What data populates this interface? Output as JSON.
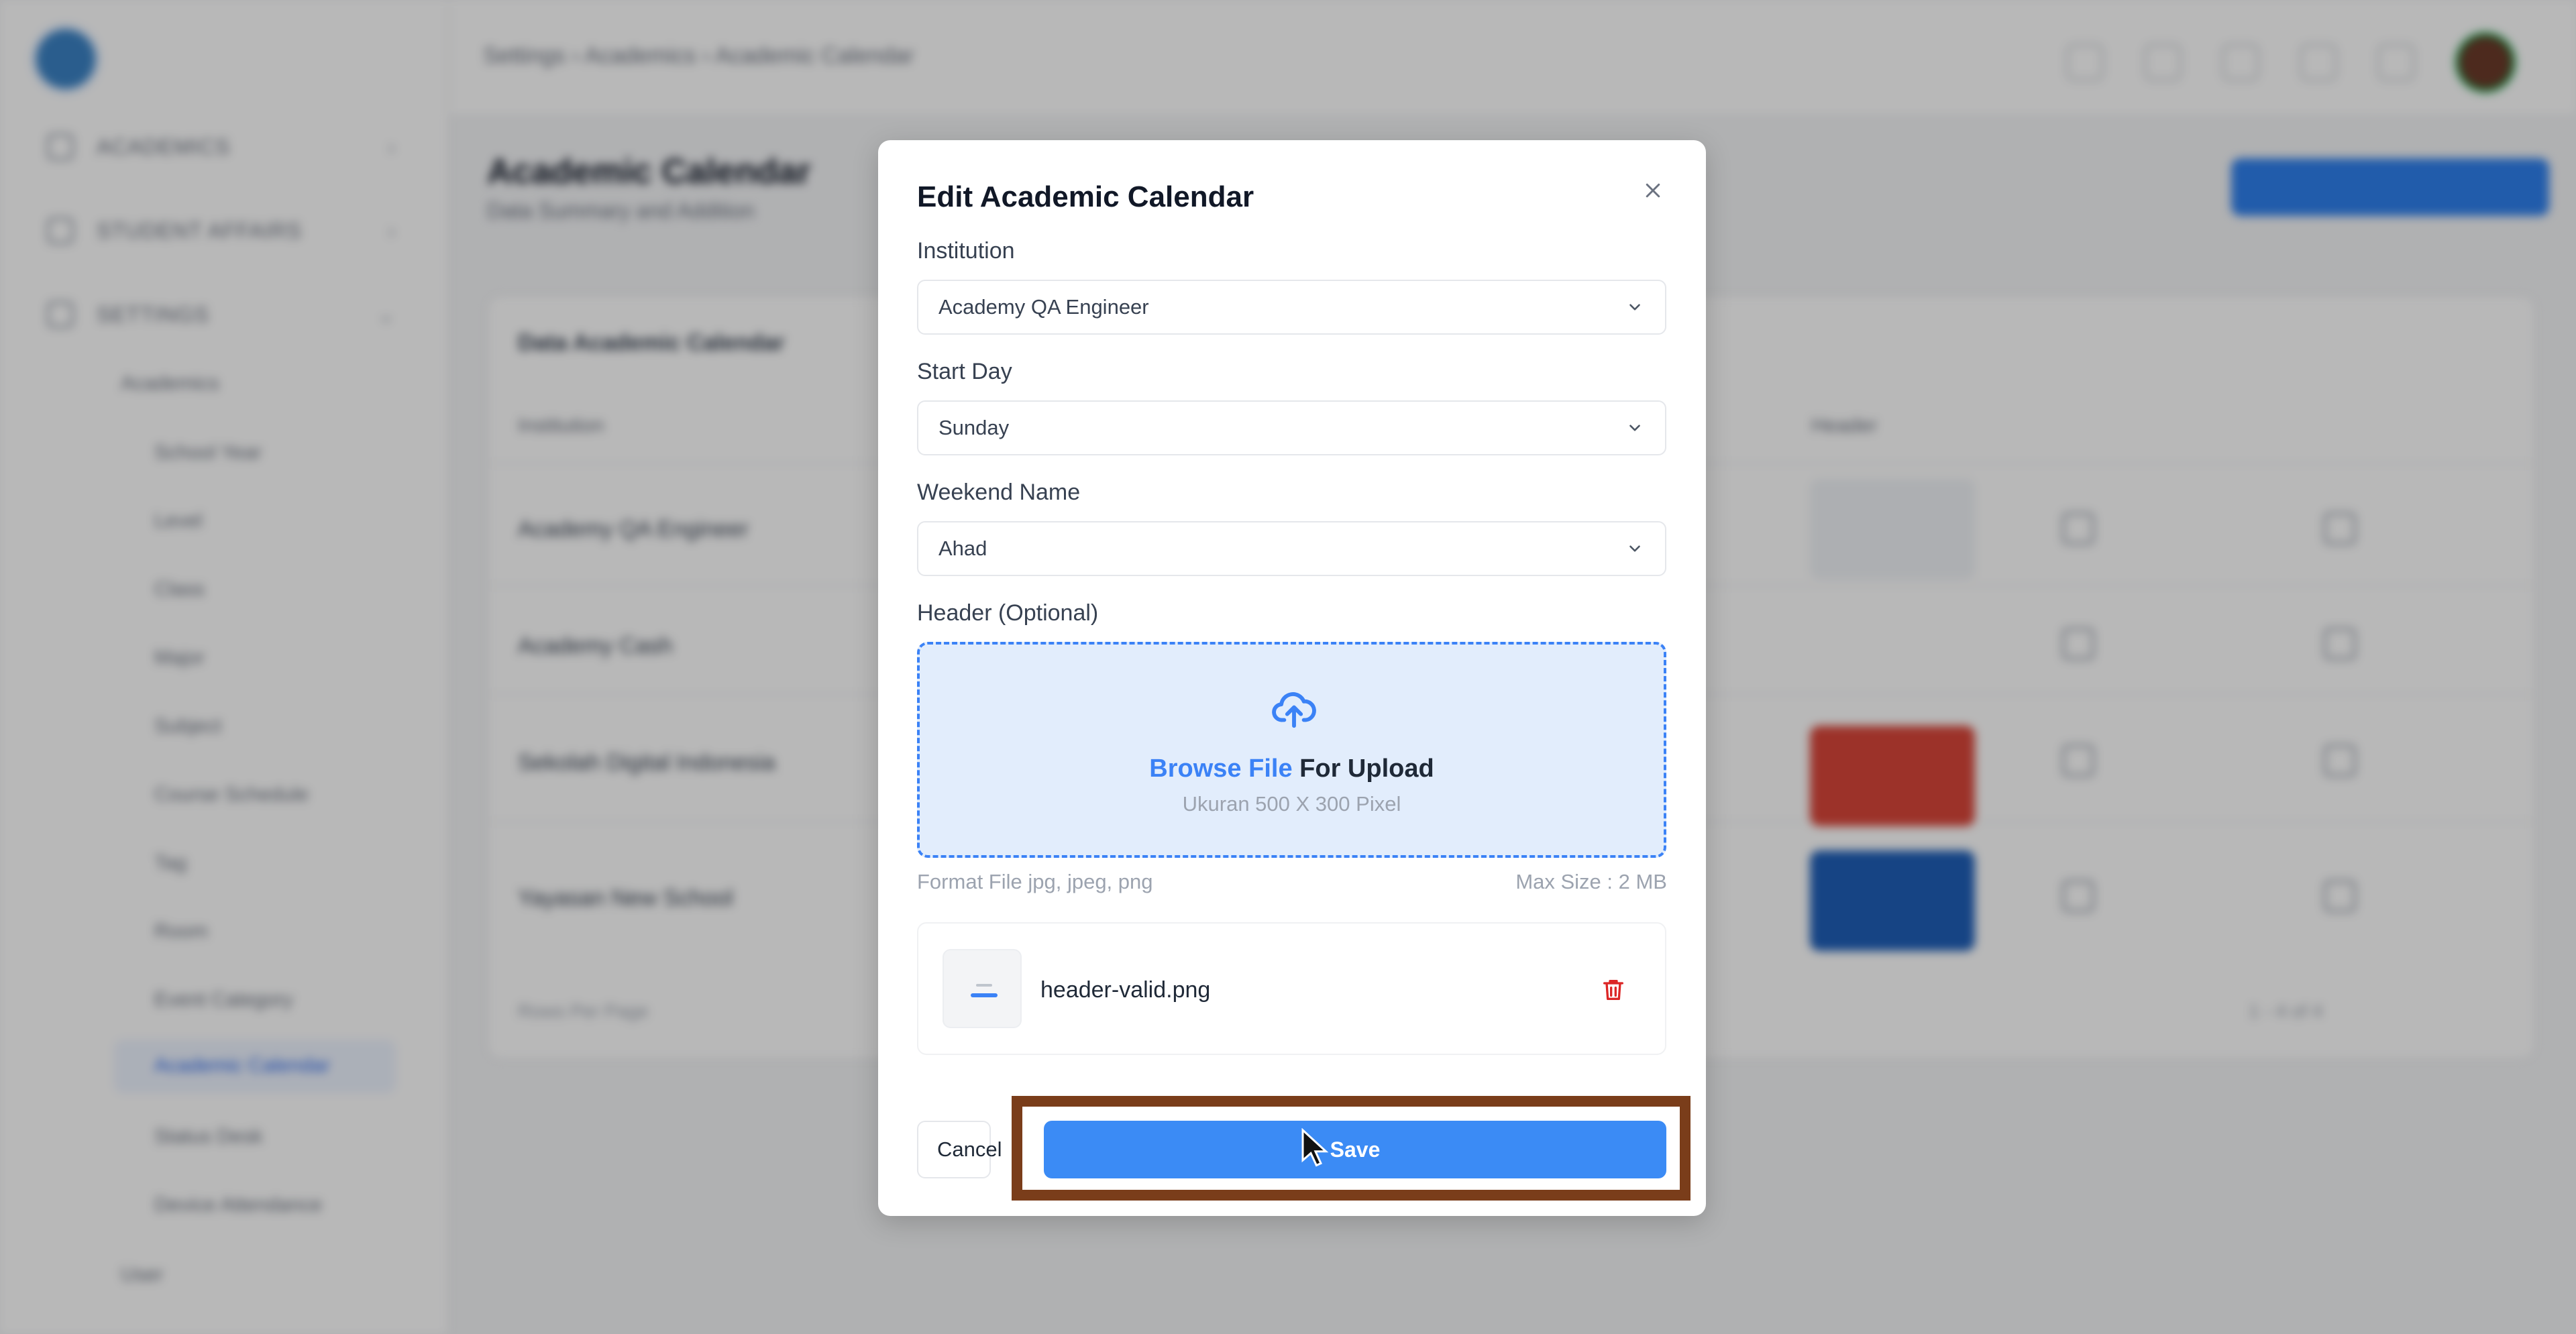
{
  "app": {
    "breadcrumb": [
      "Settings",
      "Academics",
      "Academic Calendar"
    ],
    "page_title": "Academic Calendar",
    "page_subtitle": "Data Summary and Addition",
    "sidebar": {
      "sections": [
        "ACADEMICS",
        "STUDENT AFFAIRS",
        "SETTINGS"
      ],
      "sub_group": "Academics",
      "items": [
        "School Year",
        "Level",
        "Class",
        "Major",
        "Subject",
        "Course Schedule",
        "Tag",
        "Room",
        "Event Category",
        "Academic Calendar",
        "Status Desk",
        "Device Attendance",
        "User"
      ],
      "active_item": "Academic Calendar"
    },
    "table": {
      "title": "Data Academic Calendar",
      "columns": [
        "Institution",
        "Header"
      ],
      "rows": [
        "Academy QA Engineer",
        "Academy Cash",
        "Sekolah Digital Indonesia",
        "Yayasan New School"
      ],
      "footer_left": "Rows Per Page",
      "footer_page": "1 - 4 of 4"
    }
  },
  "modal": {
    "title": "Edit Academic Calendar",
    "close_icon": "close-icon",
    "institution": {
      "label": "Institution",
      "value": "Academy QA Engineer"
    },
    "start_day": {
      "label": "Start Day",
      "value": "Sunday"
    },
    "weekend_name": {
      "label": "Weekend Name",
      "value": "Ahad"
    },
    "header": {
      "label": "Header (Optional)",
      "browse_link": "Browse File",
      "browse_rest": " For Upload",
      "size_hint": "Ukuran 500 X 300 Pixel",
      "format_hint": "Format File jpg, jpeg, png",
      "max_hint": "Max Size : 2 MB"
    },
    "file": {
      "name": "header-valid.png"
    },
    "cancel_label": "Cancel",
    "save_label": "Save"
  },
  "colors": {
    "accent": "#3b8bf5",
    "link": "#3b82f6",
    "delete": "#dc2626",
    "highlight_border": "#7a3d1a",
    "dropzone_bg": "#e2edfc"
  }
}
